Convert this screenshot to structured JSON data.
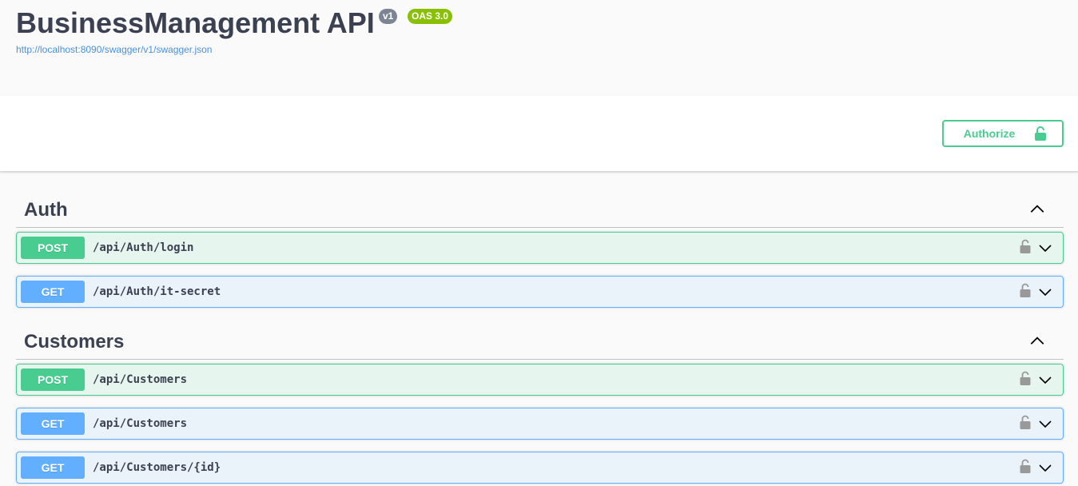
{
  "info": {
    "title": "BusinessManagement API",
    "version_badge": "v1",
    "oas_badge": "OAS 3.0",
    "spec_url": "http://localhost:8090/swagger/v1/swagger.json"
  },
  "scheme": {
    "authorize_label": "Authorize"
  },
  "colors": {
    "post": "#49cc90",
    "get": "#61affe",
    "text": "#3b4151",
    "link": "#4990e2"
  },
  "tags": [
    {
      "name": "Auth",
      "operations": [
        {
          "method": "POST",
          "path": "/api/Auth/login"
        },
        {
          "method": "GET",
          "path": "/api/Auth/it-secret"
        }
      ]
    },
    {
      "name": "Customers",
      "operations": [
        {
          "method": "POST",
          "path": "/api/Customers"
        },
        {
          "method": "GET",
          "path": "/api/Customers"
        },
        {
          "method": "GET",
          "path": "/api/Customers/{id}"
        }
      ]
    }
  ],
  "icons": {
    "collapse": "chevron-up-icon",
    "expand": "chevron-down-icon",
    "lock": "lock-icon"
  }
}
